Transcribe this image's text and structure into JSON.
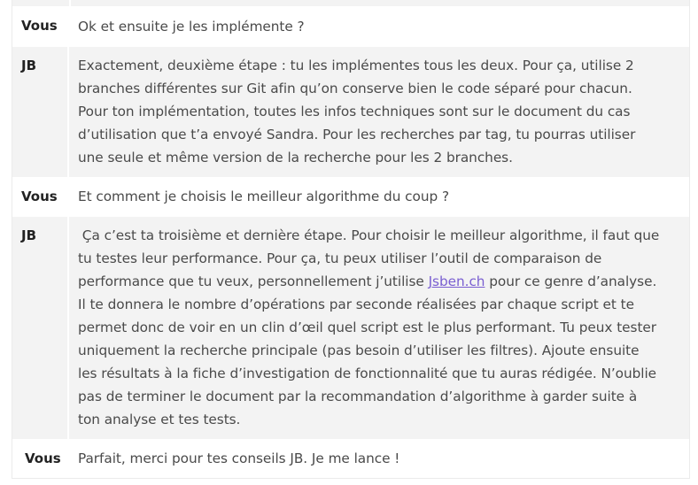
{
  "rows": [
    {
      "speaker": "Vous",
      "lines": [
        "Ok et ensuite je les implémente ?"
      ]
    },
    {
      "speaker": "JB",
      "lines": [
        "Exactement, deuxième étape : tu les implémentes tous les deux. Pour ça, utilise 2",
        "branches différentes sur Git afin qu’on conserve bien le code séparé pour chacun.",
        "Pour ton implémentation, toutes les infos techniques sont sur le document du cas",
        "d’utilisation que t’a envoyé Sandra. Pour les recherches par tag, tu pourras utiliser",
        "une seule et même version de la recherche pour les 2 branches."
      ]
    },
    {
      "speaker": "Vous",
      "lines": [
        "Et comment je choisis le meilleur algorithme du coup ?"
      ]
    },
    {
      "speaker": "JB",
      "lines": [
        " Ça c’est ta troisième et dernière étape. Pour choisir le meilleur algorithme, il faut que",
        "tu testes leur performance. Pour ça, tu peux utiliser l’outil de comparaison de"
      ],
      "link_line": {
        "before": "performance que tu veux, personnellement j’utilise ",
        "link": "Jsben.ch",
        "after": " pour ce genre d’analyse."
      },
      "lines_after": [
        "Il te donnera le nombre d’opérations par seconde réalisées par chaque script et te",
        "permet donc de voir en un clin d’œil quel script est le plus performant. Tu peux tester",
        "uniquement la recherche principale (pas besoin d’utiliser les filtres). Ajoute ensuite",
        "les résultats à la fiche d’investigation de fonctionnalité que tu auras rédigée. N’oublie",
        "pas de terminer le document par la recommandation d’algorithme à garder suite à",
        "ton analyse et tes tests."
      ]
    },
    {
      "speaker": "Vous",
      "lines": [
        "Parfait, merci pour tes conseils JB. Je me lance !"
      ]
    }
  ]
}
